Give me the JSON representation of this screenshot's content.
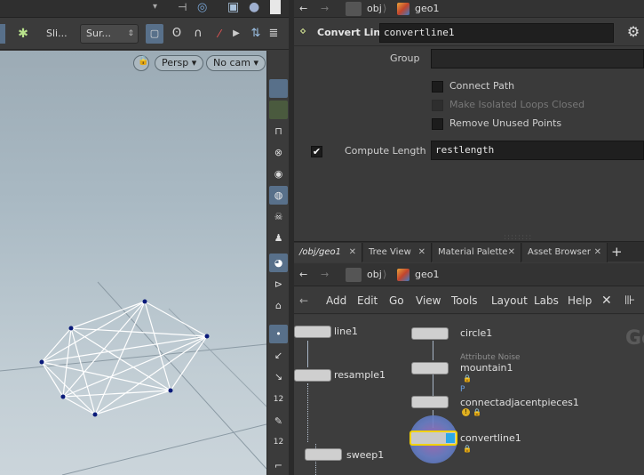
{
  "viewport": {
    "toolbar": {
      "sli_label": "Sli...",
      "sur_label": "Sur..."
    },
    "camera_label": "Persp",
    "nocam_label": "No cam"
  },
  "param_path": {
    "obj": "obj",
    "geo": "geo1"
  },
  "param_header": {
    "node_type": "Convert Line",
    "node_name": "convertline1"
  },
  "params": {
    "group_label": "Group",
    "group_value": "",
    "connect_path": "Connect Path",
    "make_loops_closed": "Make Isolated Loops Closed",
    "remove_unused": "Remove Unused Points",
    "compute_length_label": "Compute Length",
    "compute_length_value": "restlength"
  },
  "net_tabs": [
    {
      "label": "/obj/geo1"
    },
    {
      "label": "Tree View"
    },
    {
      "label": "Material Palette"
    },
    {
      "label": "Asset Browser"
    }
  ],
  "net_path": {
    "obj": "obj",
    "geo": "geo1"
  },
  "net_menu": {
    "add": "Add",
    "edit": "Edit",
    "go": "Go",
    "view": "View",
    "tools": "Tools",
    "layout": "Layout",
    "labs": "Labs",
    "help": "Help"
  },
  "nodes": {
    "line1": "line1",
    "resample1": "resample1",
    "sweep1": "sweep1",
    "circle1": "circle1",
    "mountain_sub": "Attribute Noise",
    "mountain1": "mountain1",
    "connect_sub": "P",
    "connect1": "connectadjacentpieces1",
    "convertline1": "convertline1"
  },
  "net_watermark": "Ge",
  "colors": {
    "accent_blue": "#58708a",
    "selected_node": "#f2d200",
    "viewport_points": "#0a1a7a"
  }
}
